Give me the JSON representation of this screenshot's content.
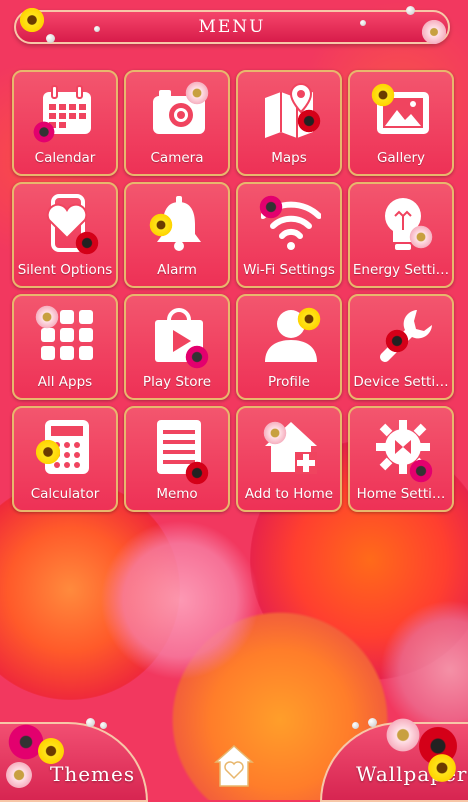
{
  "header": {
    "title": "MENU"
  },
  "tiles": [
    {
      "label": "Calendar",
      "icon": "calendar-icon"
    },
    {
      "label": "Camera",
      "icon": "camera-icon"
    },
    {
      "label": "Maps",
      "icon": "map-icon"
    },
    {
      "label": "Gallery",
      "icon": "gallery-icon"
    },
    {
      "label": "Silent Options",
      "icon": "phone-heart-icon"
    },
    {
      "label": "Alarm",
      "icon": "bell-icon"
    },
    {
      "label": "Wi-Fi Settings",
      "icon": "wifi-icon"
    },
    {
      "label": "Energy Setti…",
      "icon": "lightbulb-icon"
    },
    {
      "label": "All Apps",
      "icon": "apps-grid-icon"
    },
    {
      "label": "Play Store",
      "icon": "play-store-icon"
    },
    {
      "label": "Profile",
      "icon": "person-icon"
    },
    {
      "label": "Device Setti…",
      "icon": "wrench-icon"
    },
    {
      "label": "Calculator",
      "icon": "calculator-icon"
    },
    {
      "label": "Memo",
      "icon": "memo-icon"
    },
    {
      "label": "Add to Home",
      "icon": "add-home-icon"
    },
    {
      "label": "Home Setti…",
      "icon": "gear-icon"
    }
  ],
  "bottom": {
    "themes_label": "Themes",
    "wallpapers_label": "Wallpapers",
    "home_icon": "home-heart-icon"
  },
  "colors": {
    "tile": "#f0445f",
    "border": "#e8b76d",
    "background": "#f2385f"
  }
}
